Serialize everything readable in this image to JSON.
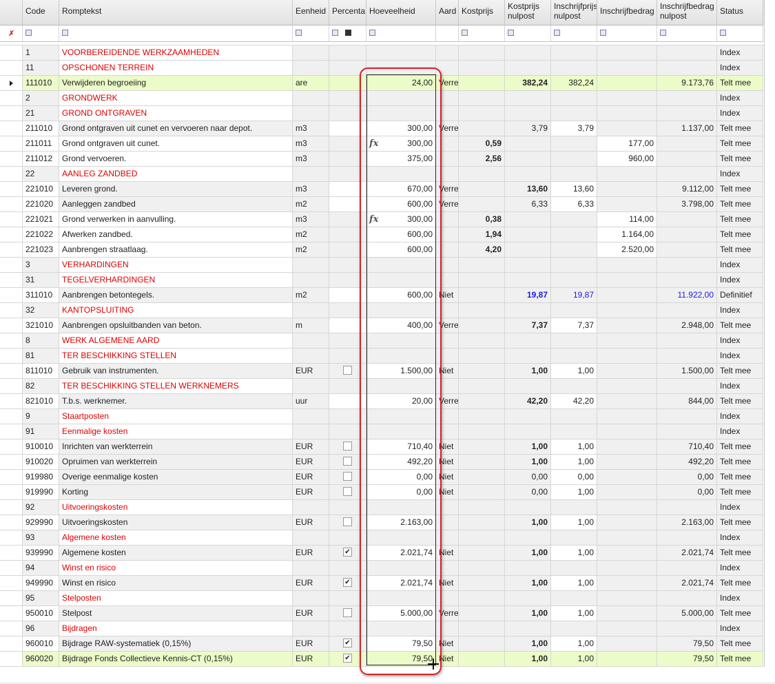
{
  "columns": {
    "code": "Code",
    "romptekst": "Romptekst",
    "eenheid": "Eenheid",
    "percenta": "Percenta",
    "hoeveelheid": "Hoeveelheid",
    "aard": "Aard",
    "kostprijs": "Kostprijs",
    "kostprijs_nulpost_1": "Kostprijs",
    "kostprijs_nulpost_2": "nulpost",
    "inschrijfprijs_1": "Inschrijfprijs",
    "inschrijfprijs_2": "nulpost",
    "inschrijfbedrag": "Inschrijfbedrag",
    "inschrijfbedrag_nulpost_1": "Inschrijfbedrag",
    "inschrijfbedrag_nulpost_2": "nulpost",
    "status": "Status"
  },
  "icons": {
    "filter_pin": "pin-icon",
    "row_pointer": "row-pointer-icon",
    "formula": "fx",
    "filter_glyph": "filter-icon"
  },
  "colors": {
    "chapter_text": "#e00000",
    "selected_row": "#ecfbc8",
    "definitive_text": "#1a1ae6",
    "highlight_border": "#d8202a"
  },
  "rows": [
    {
      "code": "1",
      "text": "VOORBEREIDENDE WERKZAAMHEDEN",
      "type": "chapter",
      "status": "Index"
    },
    {
      "code": "11",
      "text": "OPSCHONEN TERREIN",
      "type": "chapter",
      "status": "Index"
    },
    {
      "code": "111010",
      "text": "Verwijderen begroeiing",
      "type": "item",
      "selected": true,
      "unit": "are",
      "qty": "24,00",
      "aard": "Verre",
      "kp_nul": "382,24",
      "ip_nul": "382,24",
      "ib_nul": "9.173,76",
      "status": "Telt mee"
    },
    {
      "code": "2",
      "text": "GRONDWERK",
      "type": "chapter",
      "status": "Index"
    },
    {
      "code": "21",
      "text": "GROND ONTGRAVEN",
      "type": "chapter",
      "status": "Index"
    },
    {
      "code": "211010",
      "text": "Grond ontgraven uit cunet en vervoeren naar depot.",
      "type": "item",
      "unit": "m3",
      "qty": "300,00",
      "aard": "Verre",
      "kp_nul": "3,79",
      "kp_nul_plain": true,
      "ip_nul": "3,79",
      "ib_nul": "1.137,00",
      "status": "Telt mee"
    },
    {
      "code": "211011",
      "text": "Grond ontgraven uit cunet.",
      "type": "sub",
      "unit": "m3",
      "fx": true,
      "qty": "300,00",
      "kp": "0,59",
      "ib": "177,00",
      "status": "Telt mee"
    },
    {
      "code": "211012",
      "text": "Grond vervoeren.",
      "type": "sub",
      "unit": "m3",
      "qty": "375,00",
      "kp": "2,56",
      "ib": "960,00",
      "status": "Telt mee"
    },
    {
      "code": "22",
      "text": "AANLEG ZANDBED",
      "type": "chapter",
      "status": "Index"
    },
    {
      "code": "221010",
      "text": "Leveren grond.",
      "type": "item",
      "unit": "m3",
      "qty": "670,00",
      "aard": "Verre",
      "kp_nul": "13,60",
      "ip_nul": "13,60",
      "ib_nul": "9.112,00",
      "status": "Telt mee"
    },
    {
      "code": "221020",
      "text": "Aanleggen zandbed",
      "type": "item",
      "unit": "m2",
      "qty": "600,00",
      "aard": "Verre",
      "kp_nul": "6,33",
      "kp_nul_plain": true,
      "ip_nul": "6,33",
      "ib_nul": "3.798,00",
      "status": "Telt mee"
    },
    {
      "code": "221021",
      "text": "Grond verwerken in aanvulling.",
      "type": "sub",
      "unit": "m3",
      "fx": true,
      "qty": "300,00",
      "kp": "0,38",
      "ib": "114,00",
      "status": "Telt mee"
    },
    {
      "code": "221022",
      "text": "Afwerken zandbed.",
      "type": "sub",
      "unit": "m2",
      "qty": "600,00",
      "kp": "1,94",
      "ib": "1.164,00",
      "status": "Telt mee"
    },
    {
      "code": "221023",
      "text": "Aanbrengen straatlaag.",
      "type": "sub",
      "unit": "m2",
      "qty": "600,00",
      "kp": "4,20",
      "ib": "2.520,00",
      "status": "Telt mee"
    },
    {
      "code": "3",
      "text": "VERHARDINGEN",
      "type": "chapter",
      "status": "Index"
    },
    {
      "code": "31",
      "text": "TEGELVERHARDINGEN",
      "type": "chapter",
      "status": "Index"
    },
    {
      "code": "311010",
      "text": "Aanbrengen betontegels.",
      "type": "item",
      "blue": true,
      "unit": "m2",
      "qty": "600,00",
      "aard": "Niet",
      "kp_nul": "19,87",
      "ip_nul": "19,87",
      "ib_nul": "11.922,00",
      "status": "Definitief"
    },
    {
      "code": "32",
      "text": "KANTOPSLUITING",
      "type": "chapter",
      "status": "Index"
    },
    {
      "code": "321010",
      "text": "Aanbrengen opsluitbanden van beton.",
      "type": "item",
      "unit": "m",
      "qty": "400,00",
      "aard": "Verre",
      "kp_nul": "7,37",
      "ip_nul": "7,37",
      "ib_nul": "2.948,00",
      "status": "Telt mee"
    },
    {
      "code": "8",
      "text": "WERK ALGEMENE AARD",
      "type": "chapter",
      "status": "Index"
    },
    {
      "code": "81",
      "text": "TER BESCHIKKING STELLEN",
      "type": "chapter",
      "status": "Index"
    },
    {
      "code": "811010",
      "text": "Gebruik van instrumenten.",
      "type": "item",
      "unit": "EUR",
      "checkbox": "off",
      "qty": "1.500,00",
      "aard": "Niet",
      "kp_nul": "1,00",
      "ip_nul": "1,00",
      "ib_nul": "1.500,00",
      "status": "Telt mee"
    },
    {
      "code": "82",
      "text": "TER BESCHIKKING STELLEN WERKNEMERS",
      "type": "chapter",
      "status": "Index"
    },
    {
      "code": "821010",
      "text": "T.b.s. werknemer.",
      "type": "item",
      "unit": "uur",
      "qty": "20,00",
      "aard": "Verre",
      "kp_nul": "42,20",
      "ip_nul": "42,20",
      "ib_nul": "844,00",
      "status": "Telt mee"
    },
    {
      "code": "9",
      "text": "Staartposten",
      "type": "chapter",
      "status": "Index"
    },
    {
      "code": "91",
      "text": "Eenmalige kosten",
      "type": "chapter",
      "status": "Index"
    },
    {
      "code": "910010",
      "text": "Inrichten van werkterrein",
      "type": "item",
      "unit": "EUR",
      "checkbox": "off",
      "qty": "710,40",
      "aard": "Niet",
      "kp_nul": "1,00",
      "ip_nul": "1,00",
      "ib_nul": "710,40",
      "status": "Telt mee"
    },
    {
      "code": "910020",
      "text": "Opruimen van werkterrein",
      "type": "item",
      "unit": "EUR",
      "checkbox": "off",
      "qty": "492,20",
      "aard": "Niet",
      "kp_nul": "1,00",
      "ip_nul": "1,00",
      "ib_nul": "492,20",
      "status": "Telt mee"
    },
    {
      "code": "919980",
      "text": "Overige eenmalige kosten",
      "type": "item",
      "unit": "EUR",
      "checkbox": "off",
      "qty": "0,00",
      "aard": "Niet",
      "kp_nul": "0,00",
      "kp_nul_plain": true,
      "ip_nul": "0,00",
      "ib_nul": "0,00",
      "status": "Telt mee"
    },
    {
      "code": "919990",
      "text": "Korting",
      "type": "item",
      "unit": "EUR",
      "checkbox": "off",
      "qty": "0,00",
      "aard": "Niet",
      "kp_nul": "0,00",
      "kp_nul_plain": true,
      "ip_nul": "1,00",
      "ib_nul": "0,00",
      "status": "Telt mee"
    },
    {
      "code": "92",
      "text": "Uitvoeringskosten",
      "type": "chapter",
      "status": "Index"
    },
    {
      "code": "929990",
      "text": "Uitvoeringskosten",
      "type": "item",
      "unit": "EUR",
      "checkbox": "off",
      "qty": "2.163,00",
      "aard": "",
      "kp_nul": "1,00",
      "ip_nul": "1,00",
      "ib_nul": "2.163,00",
      "status": "Telt mee"
    },
    {
      "code": "93",
      "text": "Algemene kosten",
      "type": "chapter",
      "status": "Index"
    },
    {
      "code": "939990",
      "text": "Algemene kosten",
      "type": "item",
      "unit": "EUR",
      "checkbox": "on",
      "qty": "2.021,74",
      "aard": "Niet",
      "kp_nul": "1,00",
      "ip_nul": "1,00",
      "ib_nul": "2.021,74",
      "status": "Telt mee"
    },
    {
      "code": "94",
      "text": "Winst en risico",
      "type": "chapter",
      "status": "Index"
    },
    {
      "code": "949990",
      "text": "Winst en risico",
      "type": "item",
      "unit": "EUR",
      "checkbox": "on",
      "qty": "2.021,74",
      "aard": "Niet",
      "kp_nul": "1,00",
      "ip_nul": "1,00",
      "ib_nul": "2.021,74",
      "status": "Telt mee"
    },
    {
      "code": "95",
      "text": "Stelposten",
      "type": "chapter",
      "status": "Index"
    },
    {
      "code": "950010",
      "text": "Stelpost",
      "type": "item",
      "unit": "EUR",
      "checkbox": "off",
      "qty": "5.000,00",
      "aard": "Verre",
      "kp_nul": "1,00",
      "ip_nul": "1,00",
      "ib_nul": "5.000,00",
      "status": "Telt mee"
    },
    {
      "code": "96",
      "text": "Bijdragen",
      "type": "chapter",
      "status": "Index"
    },
    {
      "code": "960010",
      "text": "Bijdrage RAW-systematiek (0,15%)",
      "type": "item",
      "unit": "EUR",
      "checkbox": "on",
      "qty": "79,50",
      "aard": "Niet",
      "kp_nul": "1,00",
      "ip_nul": "1,00",
      "ib_nul": "79,50",
      "status": "Telt mee"
    },
    {
      "code": "960020",
      "text": "Bijdrage Fonds Collectieve Kennis-CT (0,15%)",
      "type": "item",
      "selected": true,
      "unit": "EUR",
      "checkbox": "on",
      "qty": "79,50",
      "aard": "Niet",
      "kp_nul": "1,00",
      "ip_nul": "1,00",
      "ib_nul": "79,50",
      "status": "Telt mee"
    }
  ]
}
